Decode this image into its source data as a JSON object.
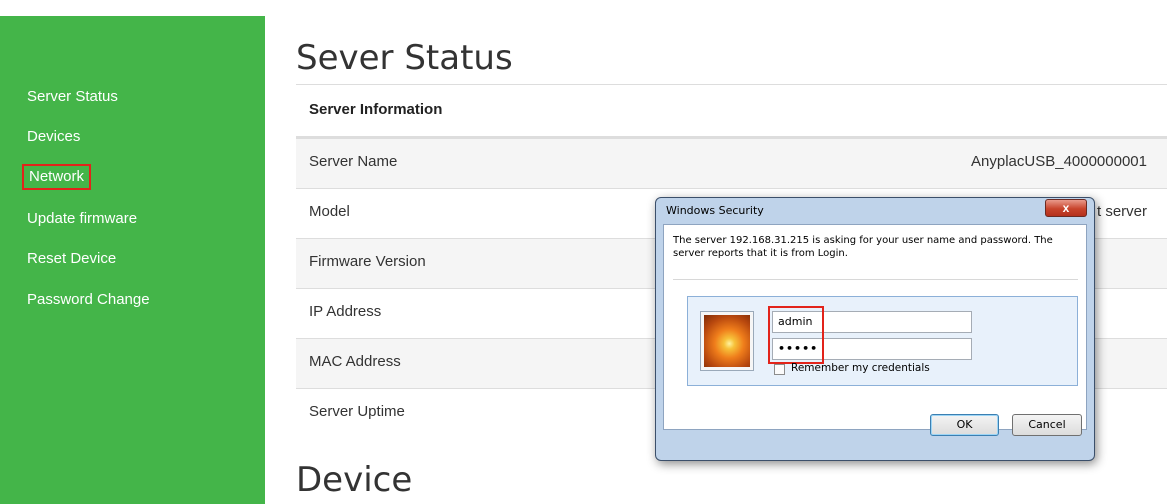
{
  "sidebar": {
    "items": [
      {
        "label": "Server Status"
      },
      {
        "label": "Devices"
      },
      {
        "label": "Network"
      },
      {
        "label": "Update firmware"
      },
      {
        "label": "Reset Device"
      },
      {
        "label": "Password Change"
      }
    ]
  },
  "main": {
    "title": "Sever Status",
    "section_header": "Server Information",
    "rows": [
      {
        "label": "Server Name",
        "value": "AnyplacUSB_4000000001"
      },
      {
        "label": "Model",
        "value": "t server"
      },
      {
        "label": "Firmware Version",
        "value": ""
      },
      {
        "label": "IP Address",
        "value": ""
      },
      {
        "label": "MAC Address",
        "value": ""
      },
      {
        "label": "Server Uptime",
        "value": ""
      }
    ],
    "device_heading": "Device"
  },
  "dialog": {
    "title": "Windows Security",
    "close_glyph": "x",
    "message": "The server 192.168.31.215 is asking for your user name and password. The server reports that it is from Login.",
    "username_value": "admin",
    "password_value": "•••••",
    "remember_label": "Remember my credentials",
    "ok_label": "OK",
    "cancel_label": "Cancel"
  },
  "colors": {
    "sidebar_bg": "#44b549",
    "highlight_box": "#e2231a"
  }
}
